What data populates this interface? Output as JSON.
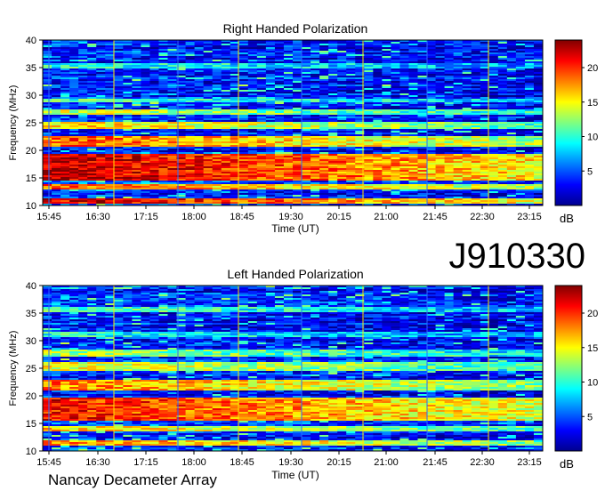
{
  "figure": {
    "id_label": "J910330",
    "footer": "Nancay Decameter Array"
  },
  "chart_data": [
    {
      "type": "heatmap",
      "title": "Right Handed Polarization",
      "xlabel": "Time (UT)",
      "ylabel": "Frequency (MHz)",
      "x_ticks": [
        "15:45",
        "16:30",
        "17:15",
        "18:00",
        "18:45",
        "19:30",
        "20:15",
        "21:00",
        "21:45",
        "22:30",
        "23:15"
      ],
      "y_ticks": [
        10,
        15,
        20,
        25,
        30,
        35,
        40
      ],
      "ylim": [
        10,
        40
      ],
      "colorbar": {
        "label": "dB",
        "ticks": [
          5,
          10,
          15,
          20
        ],
        "range": [
          0,
          24
        ],
        "colormap": "jet"
      },
      "grid": false,
      "bands": [
        {
          "freq": [
            10.4,
            11.2
          ],
          "level": 22
        },
        {
          "freq": [
            13.0,
            13.8
          ],
          "level": 19
        },
        {
          "freq": [
            14.6,
            19.5
          ],
          "level": 23
        },
        {
          "freq": [
            20.5,
            22.5
          ],
          "level": 19
        },
        {
          "freq": [
            24.0,
            25.2
          ],
          "level": 16
        },
        {
          "freq": [
            26.5,
            27.5
          ],
          "level": 14
        },
        {
          "freq": [
            28.6,
            29.5
          ],
          "level": 11
        },
        {
          "freq": [
            35.0,
            35.8
          ],
          "level": 10
        }
      ]
    },
    {
      "type": "heatmap",
      "title": "Left Handed Polarization",
      "xlabel": "Time (UT)",
      "ylabel": "Frequency (MHz)",
      "x_ticks": [
        "15:45",
        "16:30",
        "17:15",
        "18:00",
        "18:45",
        "19:30",
        "20:15",
        "21:00",
        "21:45",
        "22:30",
        "23:15"
      ],
      "y_ticks": [
        10,
        15,
        20,
        25,
        30,
        35,
        40
      ],
      "ylim": [
        10,
        40
      ],
      "colorbar": {
        "label": "dB",
        "ticks": [
          5,
          10,
          15,
          20
        ],
        "range": [
          0,
          24
        ],
        "colormap": "jet"
      },
      "grid": false,
      "bands": [
        {
          "freq": [
            11.0,
            12.0
          ],
          "level": 18
        },
        {
          "freq": [
            13.5,
            14.5
          ],
          "level": 16
        },
        {
          "freq": [
            15.5,
            19.8
          ],
          "level": 21
        },
        {
          "freq": [
            21.0,
            23.0
          ],
          "level": 18
        },
        {
          "freq": [
            24.5,
            26.0
          ],
          "level": 15
        },
        {
          "freq": [
            27.2,
            28.3
          ],
          "level": 13
        },
        {
          "freq": [
            30.5,
            31.5
          ],
          "level": 10
        },
        {
          "freq": [
            35.2,
            36.0
          ],
          "level": 11
        }
      ]
    }
  ],
  "colors": {
    "jet": [
      "#00008f",
      "#0000ff",
      "#0080ff",
      "#00ffff",
      "#80ff80",
      "#ffff00",
      "#ff8000",
      "#ff0000",
      "#800000"
    ],
    "marker_yellow": "#ffe600",
    "marker_blue": "#2a6dff"
  }
}
